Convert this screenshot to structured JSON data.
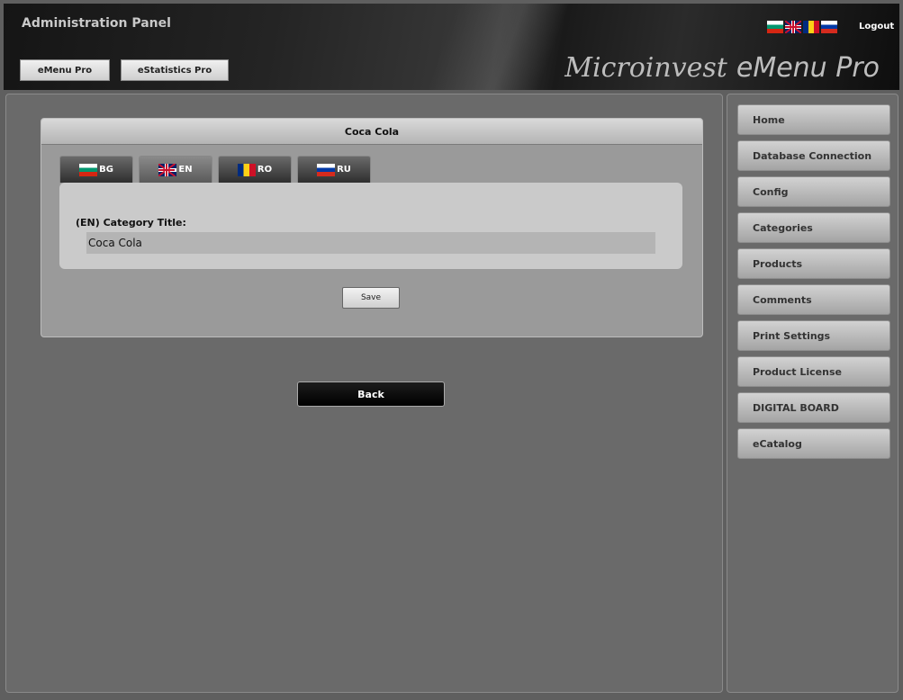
{
  "header": {
    "title": "Administration Panel",
    "buttons": [
      "eMenu Pro",
      "eStatistics Pro"
    ],
    "languages": [
      "BG",
      "EN",
      "RO",
      "RU"
    ],
    "logout_label": "Logout",
    "brand_part1": "Microinvest",
    "brand_part2": "eMenu Pro"
  },
  "card": {
    "title": "Coca Cola",
    "tabs": [
      {
        "code": "BG",
        "flag": "flag-bulgaria-icon",
        "active": false
      },
      {
        "code": "EN",
        "flag": "flag-uk-icon",
        "active": true
      },
      {
        "code": "RO",
        "flag": "flag-romania-icon",
        "active": false
      },
      {
        "code": "RU",
        "flag": "flag-russia-icon",
        "active": false
      }
    ],
    "field_label": "(EN) Category Title:",
    "field_value": "Coca Cola",
    "save_label": "Save"
  },
  "back_label": "Back",
  "sidebar": {
    "items": [
      "Home",
      "Database Connection",
      "Config",
      "Categories",
      "Products",
      "Comments",
      "Print Settings",
      "Product License",
      "DIGITAL BOARD",
      "eCatalog"
    ]
  },
  "colors": {
    "background": "#5f5f5f",
    "header_dark": "#151515",
    "button_light": "#e6e6e6"
  }
}
